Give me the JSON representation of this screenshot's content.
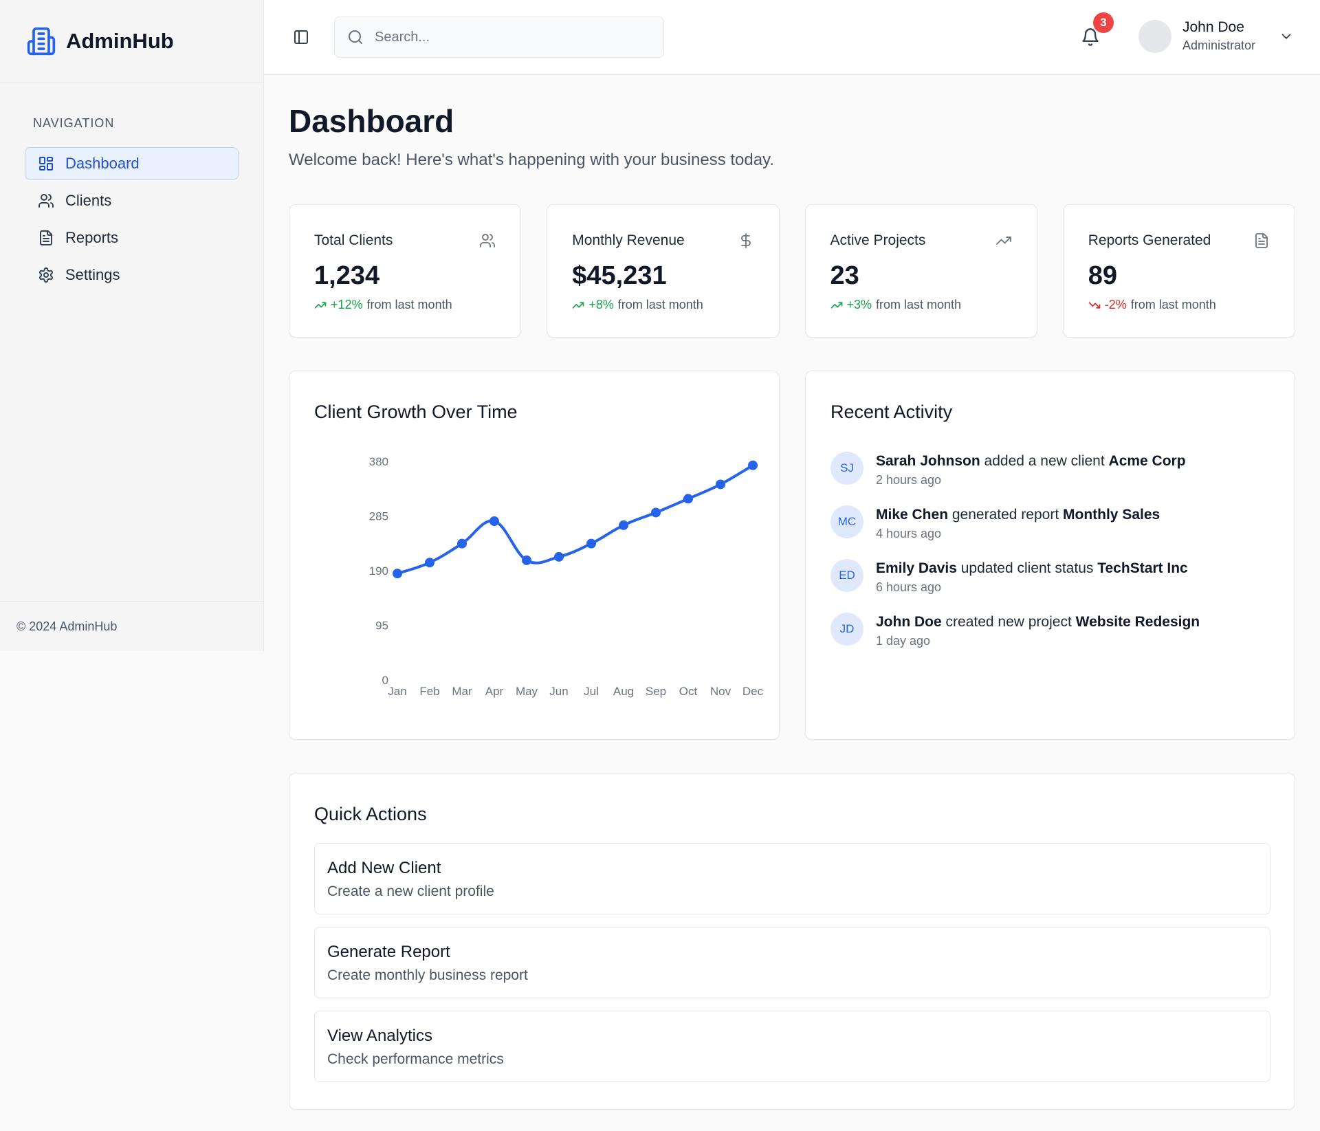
{
  "app": {
    "name": "AdminHub",
    "footer": "© 2024 AdminHub"
  },
  "sidebar": {
    "section_label": "NAVIGATION",
    "items": [
      {
        "label": "Dashboard",
        "icon": "grid-icon",
        "active": true
      },
      {
        "label": "Clients",
        "icon": "users-icon",
        "active": false
      },
      {
        "label": "Reports",
        "icon": "document-icon",
        "active": false
      },
      {
        "label": "Settings",
        "icon": "gear-icon",
        "active": false
      }
    ]
  },
  "header": {
    "search_placeholder": "Search...",
    "notifications_count": "3",
    "user_name": "John Doe",
    "user_role": "Administrator"
  },
  "page": {
    "title": "Dashboard",
    "subtitle": "Welcome back! Here's what's happening with your business today."
  },
  "stats": [
    {
      "title": "Total Clients",
      "value": "1,234",
      "change": "+12%",
      "suffix": "from last month",
      "trend": "up",
      "icon": "users-icon"
    },
    {
      "title": "Monthly Revenue",
      "value": "$45,231",
      "change": "+8%",
      "suffix": "from last month",
      "trend": "up",
      "icon": "dollar-icon"
    },
    {
      "title": "Active Projects",
      "value": "23",
      "change": "+3%",
      "suffix": "from last month",
      "trend": "up",
      "icon": "trending-up-icon"
    },
    {
      "title": "Reports Generated",
      "value": "89",
      "change": "-2%",
      "suffix": "from last month",
      "trend": "down",
      "icon": "document-icon"
    }
  ],
  "chart_card": {
    "title": "Client Growth Over Time"
  },
  "chart_data": {
    "type": "line",
    "title": "Client Growth Over Time",
    "categories": [
      "Jan",
      "Feb",
      "Mar",
      "Apr",
      "May",
      "Jun",
      "Jul",
      "Aug",
      "Sep",
      "Oct",
      "Nov",
      "Dec"
    ],
    "series": [
      {
        "values": [
          185,
          204,
          237,
          276,
          208,
          214,
          237,
          269,
          291,
          315,
          340,
          373
        ]
      }
    ],
    "yticks": [
      "0",
      "95",
      "190",
      "285",
      "380"
    ],
    "ylim": [
      0,
      380
    ],
    "color": "#2563eb",
    "grid": false,
    "legend": "none"
  },
  "activity": {
    "title": "Recent Activity",
    "items": [
      {
        "initials": "SJ",
        "actor": "Sarah Johnson",
        "action": "added a new client",
        "target": "Acme Corp",
        "time": "2 hours ago"
      },
      {
        "initials": "MC",
        "actor": "Mike Chen",
        "action": "generated report",
        "target": "Monthly Sales",
        "time": "4 hours ago"
      },
      {
        "initials": "ED",
        "actor": "Emily Davis",
        "action": "updated client status",
        "target": "TechStart Inc",
        "time": "6 hours ago"
      },
      {
        "initials": "JD",
        "actor": "John Doe",
        "action": "created new project",
        "target": "Website Redesign",
        "time": "1 day ago"
      }
    ]
  },
  "quick_actions": {
    "title": "Quick Actions",
    "items": [
      {
        "title": "Add New Client",
        "desc": "Create a new client profile"
      },
      {
        "title": "Generate Report",
        "desc": "Create monthly business report"
      },
      {
        "title": "View Analytics",
        "desc": "Check performance metrics"
      }
    ]
  },
  "colors": {
    "accent": "#2563eb",
    "positive": "#16a34a",
    "negative": "#dc2626",
    "badge": "#ef4444"
  }
}
